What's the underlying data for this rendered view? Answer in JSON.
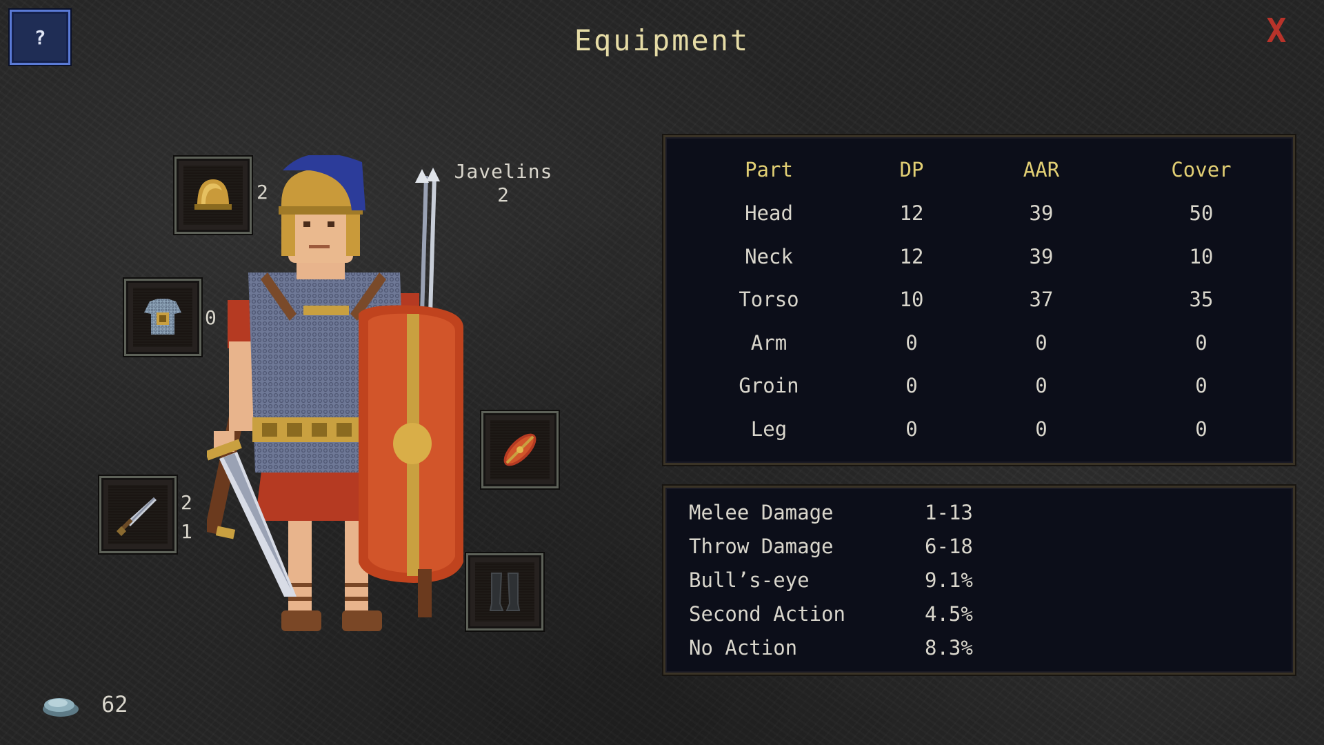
{
  "header": {
    "title": "Equipment",
    "help_label": "?",
    "close_label": "X"
  },
  "slots": {
    "helmet": {
      "icon": "helmet-icon",
      "count": "2"
    },
    "armor": {
      "icon": "mail-armor-icon",
      "count": "0"
    },
    "weapon": {
      "icon": "gladius-icon",
      "count_top": "2",
      "count_bottom": "1"
    },
    "shield": {
      "icon": "shield-icon"
    },
    "greaves": {
      "icon": "greaves-icon"
    }
  },
  "javelins": {
    "label": "Javelins",
    "count": "2"
  },
  "armor_table": {
    "headers": [
      "Part",
      "DP",
      "AAR",
      "Cover"
    ],
    "rows": [
      [
        "Head",
        "12",
        "39",
        "50"
      ],
      [
        "Neck",
        "12",
        "39",
        "10"
      ],
      [
        "Torso",
        "10",
        "37",
        "35"
      ],
      [
        "Arm",
        "0",
        "0",
        "0"
      ],
      [
        "Groin",
        "0",
        "0",
        "0"
      ],
      [
        "Leg",
        "0",
        "0",
        "0"
      ]
    ]
  },
  "combat_stats": [
    {
      "label": "Melee Damage",
      "value": "1-13"
    },
    {
      "label": "Throw Damage",
      "value": "6-18"
    },
    {
      "label": "Bull’s-eye",
      "value": "9.1%"
    },
    {
      "label": "Second Action",
      "value": "4.5%"
    },
    {
      "label": "No Action",
      "value": "8.3%"
    }
  ],
  "coins": {
    "icon": "coin-pouch-icon",
    "count": "62"
  },
  "colors": {
    "title": "#e6dca6",
    "header_text": "#e2cf74",
    "close": "#b8332a",
    "help_border": "#5a7ad6",
    "panel_bg": "#0c0e19"
  }
}
